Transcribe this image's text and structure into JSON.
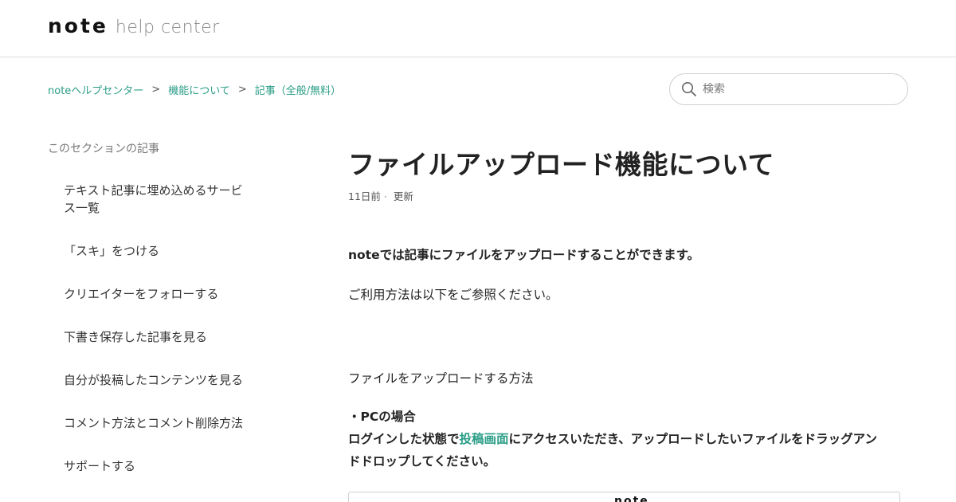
{
  "header": {
    "logo_word": "note",
    "logo_sub": "help center"
  },
  "breadcrumb": [
    {
      "label": "noteヘルプセンター"
    },
    {
      "label": "機能について"
    },
    {
      "label": "記事（全般/無料）"
    }
  ],
  "breadcrumb_separator": ">",
  "search": {
    "placeholder": "検索",
    "icon": "search-icon"
  },
  "sidebar": {
    "title": "このセクションの記事",
    "items": [
      {
        "line1": "テキスト記事に埋め込めるサービ",
        "line2": "ス一覧"
      },
      {
        "line1": "「スキ」をつける"
      },
      {
        "line1": "クリエイターをフォローする"
      },
      {
        "line1": "下書き保存した記事を見る"
      },
      {
        "line1": "自分が投稿したコンテンツを見る"
      },
      {
        "line1": "コメント方法とコメント削除方法"
      },
      {
        "line1": "サポートする"
      }
    ]
  },
  "article": {
    "title": "ファイルアップロード機能について",
    "meta_age": "11日前",
    "meta_dot": "·",
    "meta_updated": "更新",
    "intro": "noteでは記事にファイルをアップロードすることができます。",
    "see_below": "ご利用方法は以下をご参照ください。",
    "section_heading": "ファイルをアップロードする方法",
    "pc_heading": "・PCの場合",
    "pc_body_before": "ログインした状態で",
    "pc_body_link": "投稿画面",
    "pc_body_after": "にアクセスいただき、アップロードしたいファイルをドラッグアン",
    "pc_body_line2": "ドドロップしてください。",
    "frame_logo": "note"
  },
  "colors": {
    "accent": "#2a9d87",
    "text": "#222222",
    "muted": "#777777",
    "border": "#dcdcdc"
  }
}
